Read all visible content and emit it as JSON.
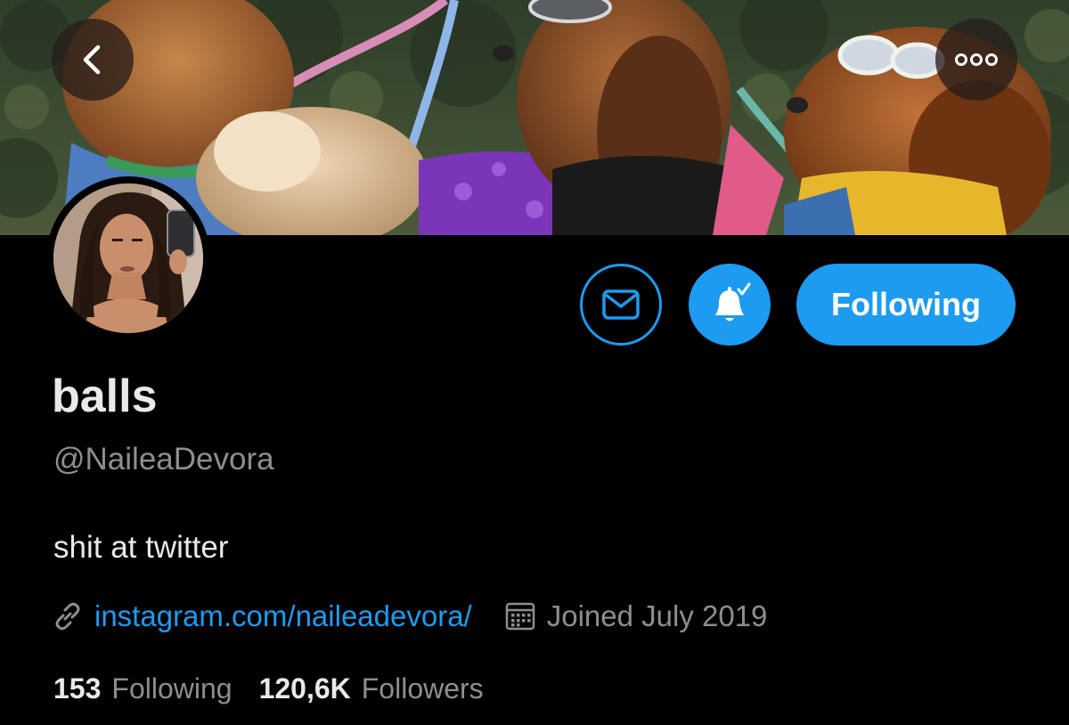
{
  "profile": {
    "display_name": "balls",
    "handle": "@NaileaDevora",
    "bio": "shit at twitter",
    "website": "instagram.com/naileadevora/",
    "joined": "Joined July 2019"
  },
  "actions": {
    "follow_label": "Following"
  },
  "stats": {
    "following_count": "153",
    "following_label": "Following",
    "followers_count": "120,6K",
    "followers_label": "Followers"
  },
  "icons": {
    "back": "chevron-left-icon",
    "more": "more-dots-icon",
    "message": "mail-icon",
    "notifications": "bell-check-icon",
    "link": "link-icon",
    "calendar": "calendar-icon"
  },
  "colors": {
    "accent": "#1d9bf0",
    "background": "#000000",
    "primary_text": "#e7e9ea",
    "secondary_text": "#8b8f94"
  }
}
